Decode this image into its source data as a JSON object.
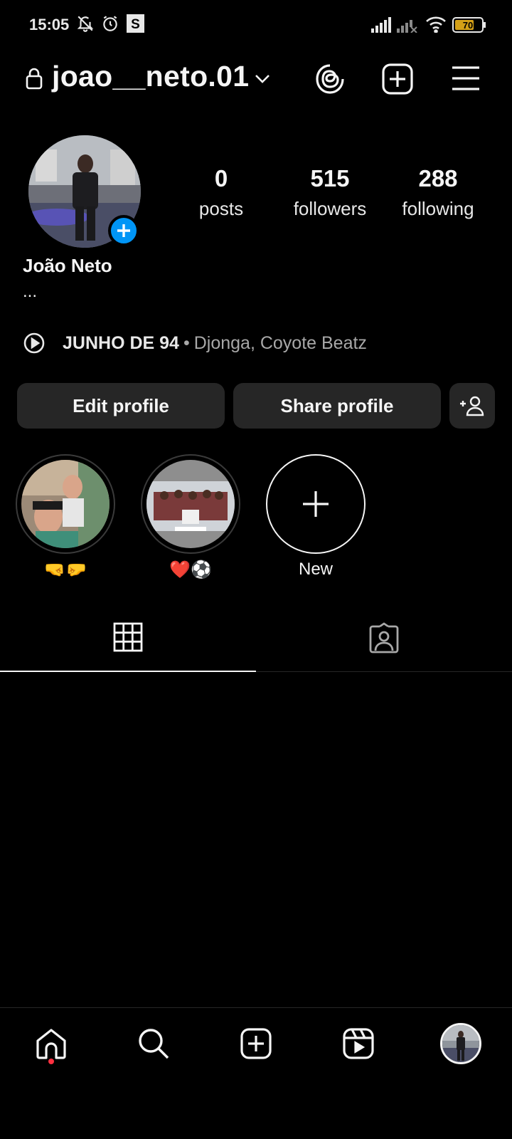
{
  "status_bar": {
    "time": "15:05",
    "icons": [
      "notifications-muted-icon",
      "alarm-icon",
      "s-app-icon",
      "signal-icon",
      "signal-no-service-icon",
      "wifi-icon",
      "battery-icon"
    ],
    "battery_level": "70"
  },
  "header": {
    "username": "joao__neto.01",
    "icons": [
      "lock-icon",
      "chevron-down-icon",
      "threads-icon",
      "create-post-icon",
      "menu-icon"
    ]
  },
  "profile": {
    "full_name": "João Neto",
    "bio": "...",
    "stats": [
      {
        "value": "0",
        "label": "posts"
      },
      {
        "value": "515",
        "label": "followers"
      },
      {
        "value": "288",
        "label": "following"
      }
    ]
  },
  "music": {
    "title": "JUNHO DE 94",
    "separator": "•",
    "artists": "Djonga, Coyote Beatz"
  },
  "buttons": {
    "edit_profile": "Edit profile",
    "share_profile": "Share profile"
  },
  "highlights": [
    {
      "label": "🤜🤛"
    },
    {
      "label": "❤️⚽"
    },
    {
      "label": "New"
    }
  ],
  "tabs": {
    "active": "grid",
    "items": [
      "grid-icon",
      "tagged-icon"
    ]
  },
  "bottom_nav": [
    "home-icon",
    "search-icon",
    "create-icon",
    "reels-icon",
    "profile-avatar"
  ],
  "colors": {
    "background": "#000000",
    "button_bg": "#262626",
    "accent_blue": "#0095f6",
    "notification_red": "#ff3040",
    "text_primary": "#f5f5f5",
    "text_secondary": "#a8a8a8"
  }
}
